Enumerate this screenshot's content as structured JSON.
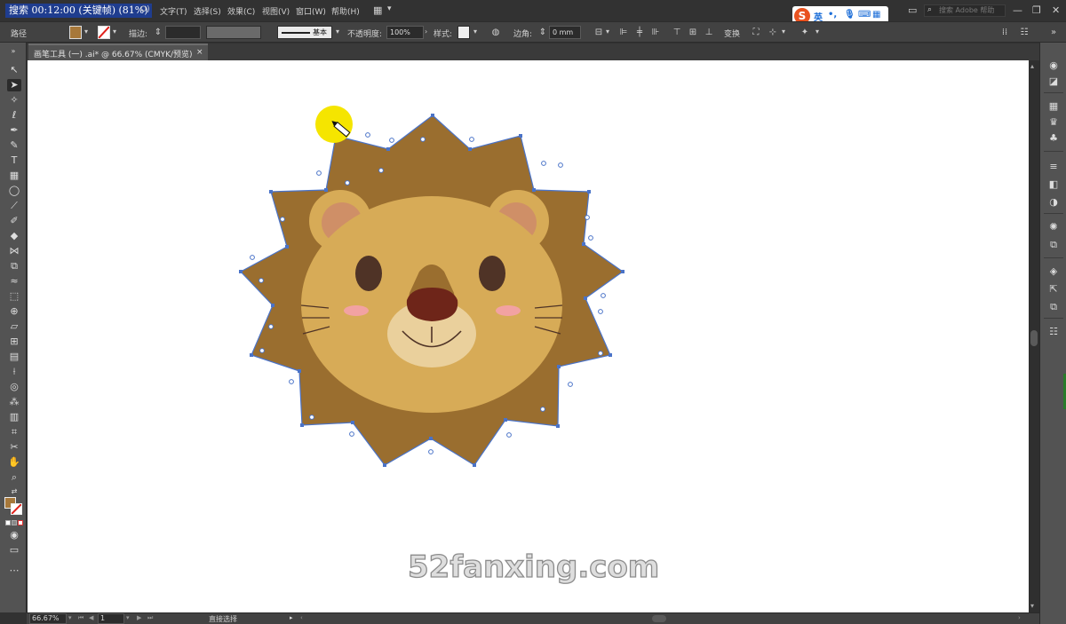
{
  "menubar": {
    "overlay_title": "搜索 00:12:00 (关键帧) (81%)",
    "items": [
      "文字(T)",
      "选择(S)",
      "效果(C)",
      "视图(V)",
      "窗口(W)",
      "帮助(H)"
    ],
    "partial_item": "O)",
    "ime": {
      "lang": "英",
      "punct": "•,"
    },
    "search_placeholder": "搜索 Adobe 帮助"
  },
  "controlbar": {
    "object_type": "路径",
    "fill_color": "#a7783a",
    "stroke_label": "描边:",
    "stroke_profile": "基本",
    "opacity_label": "不透明度:",
    "opacity_value": "100%",
    "style_label": "样式:",
    "corner_label": "边角:",
    "corner_value": "0 mm",
    "transform_label": "变换"
  },
  "document_tab": {
    "label": "画笔工具 (一) .ai* @ 66.67% (CMYK/预览)",
    "close": "×"
  },
  "tools": [
    "selection-tool",
    "direct-selection-tool",
    "magic-wand-tool",
    "lasso-tool",
    "pen-tool",
    "curvature-tool",
    "type-tool",
    "table-tool",
    "ellipse-tool",
    "paintbrush-tool",
    "blob-brush-tool",
    "eraser-tool",
    "reflect-tool",
    "scale-tool",
    "warp-tool",
    "free-transform-tool",
    "shape-builder-tool",
    "perspective-grid-tool",
    "mesh-tool",
    "gradient-tool",
    "eyedropper-tool",
    "blend-tool",
    "symbol-sprayer-tool",
    "column-graph-tool",
    "artboard-tool",
    "slice-tool",
    "hand-tool",
    "zoom-tool"
  ],
  "colors": {
    "fill": "#a7783a",
    "mane": "#9a6e2f",
    "face": "#d7ab57",
    "ear_inner": "#cf8f67",
    "muzzle": "#ead09c",
    "nose": "#6e2519",
    "eye": "#4f3326",
    "blush": "#f2a2a2",
    "selection": "#4a73c8",
    "highlight": "#f5e500"
  },
  "canvas": {
    "watermark": "52fanxing.com"
  },
  "statusbar": {
    "zoom": "66.67%",
    "artboard": "1",
    "tool_name": "直接选择"
  }
}
